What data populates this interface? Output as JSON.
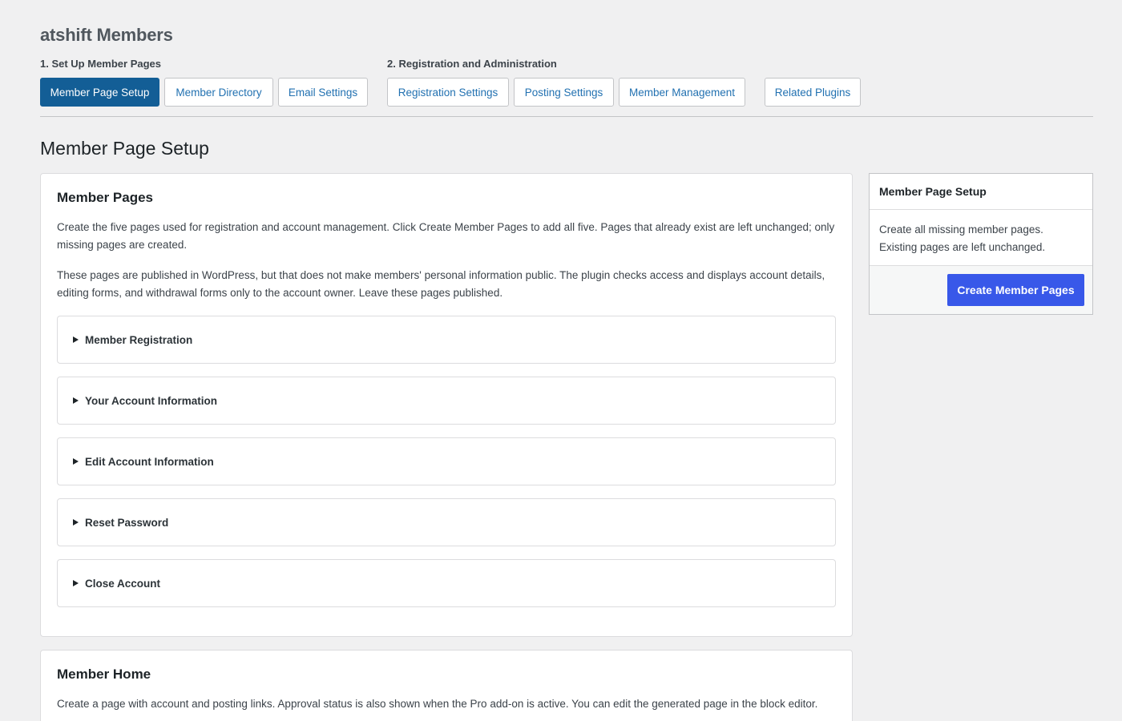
{
  "app": {
    "title": "atshift Members"
  },
  "nav": {
    "group1_label": "1. Set Up Member Pages",
    "group2_label": "2. Registration and Administration",
    "tabs": [
      {
        "label": "Member Page Setup",
        "active": true
      },
      {
        "label": "Member Directory",
        "active": false
      },
      {
        "label": "Email Settings",
        "active": false
      },
      {
        "label": "Registration Settings",
        "active": false
      },
      {
        "label": "Posting Settings",
        "active": false
      },
      {
        "label": "Member Management",
        "active": false
      },
      {
        "label": "Related Plugins",
        "active": false
      }
    ]
  },
  "page": {
    "title": "Member Page Setup"
  },
  "member_pages": {
    "title": "Member Pages",
    "description_1": "Create the five pages used for registration and account management. Click Create Member Pages to add all five. Pages that already exist are left unchanged; only missing pages are created.",
    "description_2": "These pages are published in WordPress, but that does not make members' personal information public. The plugin checks access and displays account details, editing forms, and withdrawal forms only to the account owner. Leave these pages published.",
    "sections": [
      {
        "label": "Member Registration",
        "expanded": false
      },
      {
        "label": "Your Account Information",
        "expanded": false
      },
      {
        "label": "Edit Account Information",
        "expanded": false
      },
      {
        "label": "Reset Password",
        "expanded": false
      },
      {
        "label": "Close Account",
        "expanded": false
      }
    ]
  },
  "member_home": {
    "title": "Member Home",
    "description": "Create a page with account and posting links. Approval status is also shown when the Pro add-on is active. You can edit the generated page in the block editor."
  },
  "sidebar": {
    "title": "Member Page Setup",
    "text": "Create all missing member pages. Existing pages are left unchanged.",
    "button_label": "Create Member Pages"
  },
  "colors": {
    "background": "#f0f0f1",
    "active_tab": "#135e96",
    "link": "#2271b1",
    "primary_button": "#3858e9"
  }
}
